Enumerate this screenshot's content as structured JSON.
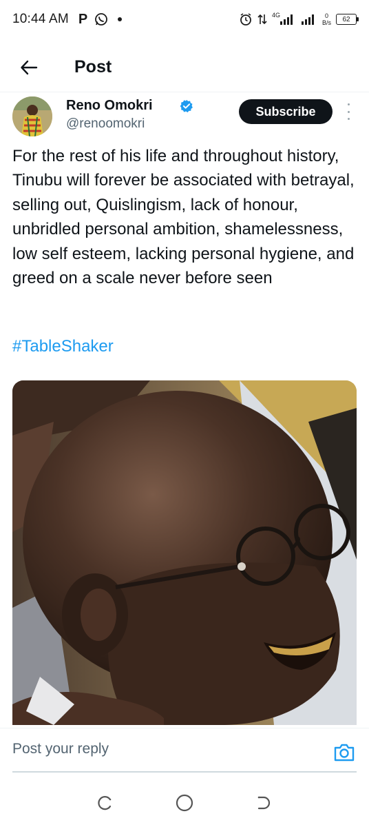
{
  "status_bar": {
    "time": "10:44 AM",
    "left_icons": [
      "p-icon",
      "whatsapp-icon",
      "dot-icon"
    ],
    "network_label": "4G",
    "data_speed_value": "0",
    "data_speed_unit": "B/s",
    "battery": "62"
  },
  "header": {
    "title": "Post"
  },
  "post": {
    "author_name": "Reno Omokri",
    "author_handle": "@renoomokri",
    "subscribe_label": "Subscribe",
    "text": "For the rest of his life and throughout history, Tinubu will forever be associated with betrayal, selling out, Quislingism, lack of honour, unbridled personal ambition, shamelessness, low self esteem, lacking personal hygiene, and greed on a scale never before seen",
    "hashtag": "#TableShaker"
  },
  "reply": {
    "placeholder": "Post your reply"
  },
  "colors": {
    "accent": "#1d9bf0",
    "text": "#0f1419",
    "secondary": "#536471",
    "button_bg": "#0f1419"
  }
}
